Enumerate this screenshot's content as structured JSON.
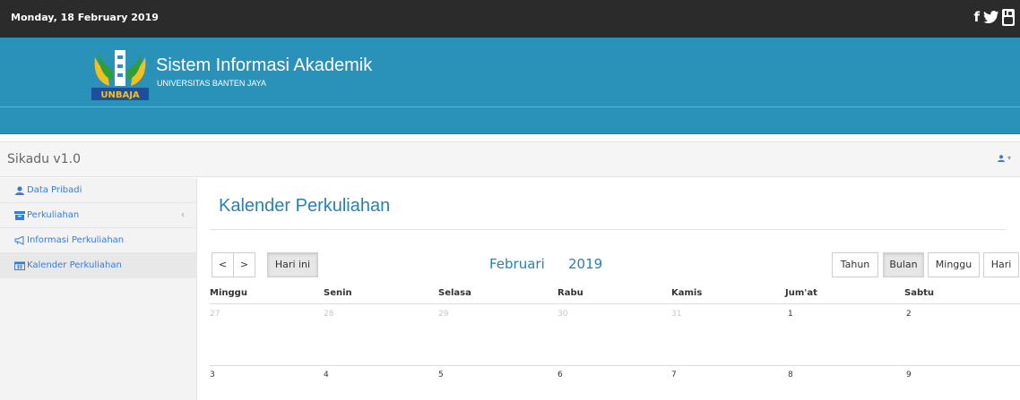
{
  "topbar": {
    "date": "Monday, 18 February 2019",
    "social_icons": [
      "facebook-icon",
      "twitter-icon",
      "youtube-icon"
    ]
  },
  "header": {
    "logo_text": "UNBAJA",
    "title": "Sistem Informasi Akademik",
    "subtitle": "UNIVERSITAS BANTEN JAYA"
  },
  "app": {
    "title": "Sikadu v1.0"
  },
  "sidebar": {
    "items": [
      {
        "label": "Data Pribadi",
        "icon": "user-icon"
      },
      {
        "label": "Perkuliahan",
        "icon": "archive-icon",
        "caret": "‹"
      },
      {
        "label": "Informasi Perkuliahan",
        "icon": "bullhorn-icon"
      },
      {
        "label": "Kalender Perkuliahan",
        "icon": "calendar-icon"
      }
    ]
  },
  "main": {
    "title": "Kalender Perkuliahan"
  },
  "calendar": {
    "prev": "<",
    "next": ">",
    "today": "Hari ini",
    "month": "Februari",
    "year": "2019",
    "views": [
      "Tahun",
      "Bulan",
      "Minggu",
      "Hari"
    ],
    "active_view": "Bulan",
    "weekdays": [
      "Minggu",
      "Senin",
      "Selasa",
      "Rabu",
      "Kamis",
      "Jum'at",
      "Sabtu"
    ],
    "week1": [
      "27",
      "28",
      "29",
      "30",
      "31",
      "1",
      "2"
    ],
    "week2": [
      "3",
      "4",
      "5",
      "6",
      "7",
      "8",
      "9"
    ]
  },
  "colors": {
    "header": "#2a92b8",
    "topbar": "#2b2b2b",
    "accent": "#2a7fb3",
    "link": "#3a7bd5"
  }
}
